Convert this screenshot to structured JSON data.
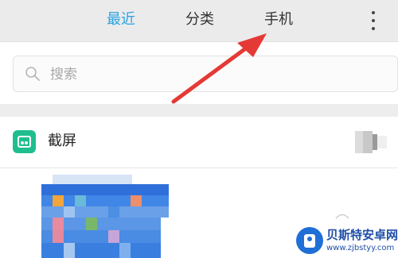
{
  "tabs": {
    "recent": "最近",
    "category": "分类",
    "phone": "手机"
  },
  "active_tab": "recent",
  "search": {
    "placeholder": "搜索"
  },
  "group": {
    "title": "截屏"
  },
  "watermark": {
    "name": "贝斯特安卓网",
    "url": "www.zjbstyy.com"
  },
  "colors": {
    "accent": "#2aa3e0",
    "folder_icon": "#1fbe8e",
    "annotation_arrow": "#e53935"
  },
  "icons": {
    "more": "more-vertical-icon",
    "search": "search-icon",
    "folder": "screenshot-folder-icon"
  }
}
